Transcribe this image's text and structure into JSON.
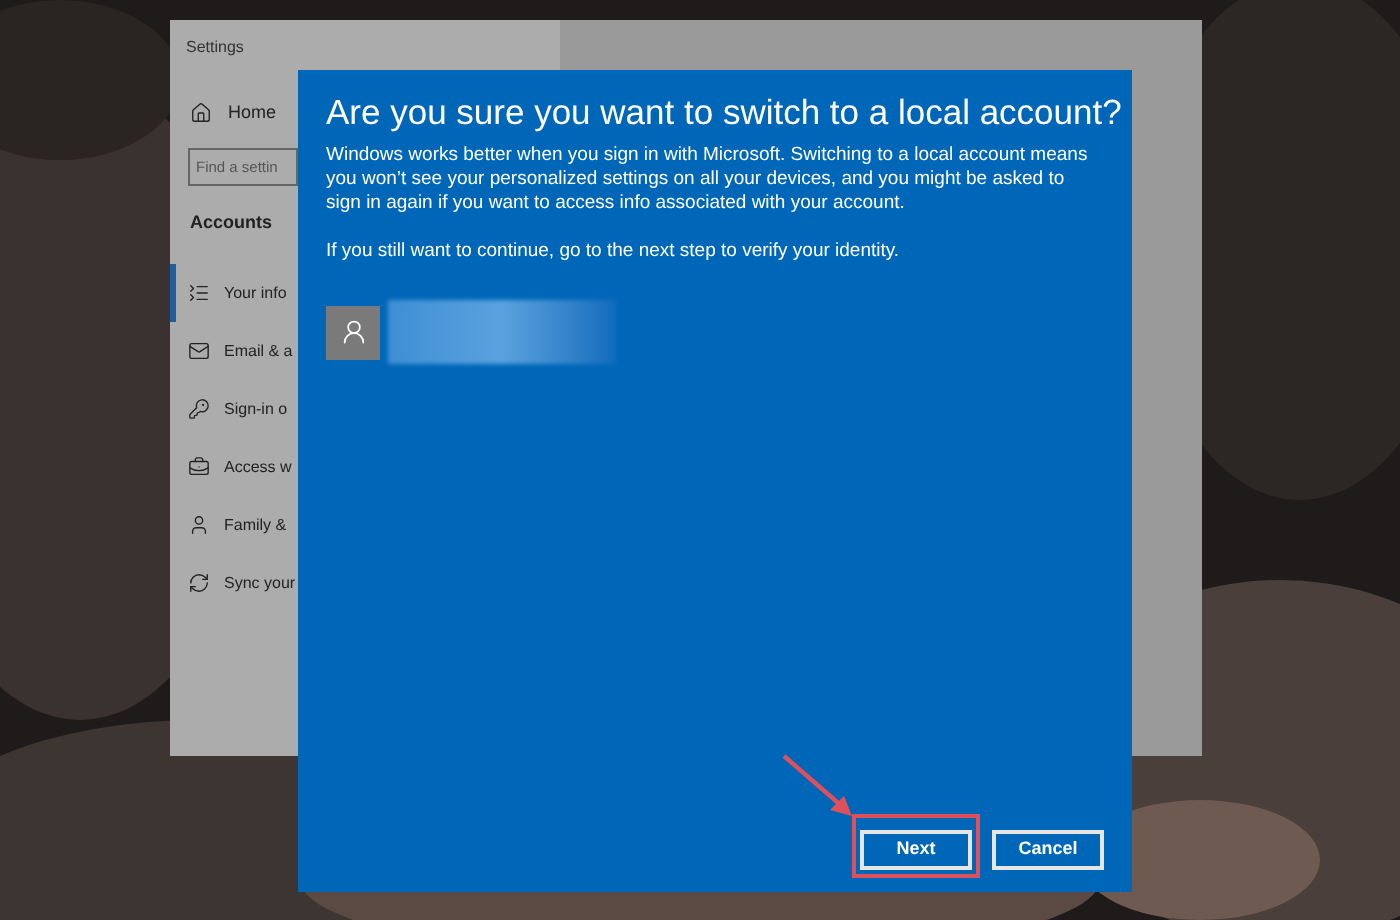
{
  "settings_window": {
    "title": "Settings",
    "home": "Home",
    "search": {
      "placeholder": "Find a settin"
    },
    "section": "Accounts",
    "items": [
      {
        "label": "Your info",
        "selected": true
      },
      {
        "label": "Email & a",
        "selected": false
      },
      {
        "label": "Sign-in o",
        "selected": false
      },
      {
        "label": "Access w",
        "selected": false
      },
      {
        "label": "Family &",
        "selected": false
      },
      {
        "label": "Sync your",
        "selected": false
      }
    ]
  },
  "dialog": {
    "title": "Are you sure you want to switch to a local account?",
    "body": "Windows works better when you sign in with Microsoft. Switching to a local account means you won’t see your personalized settings on all your devices, and you might be asked to sign in again if you want to access info associated with your account.",
    "note": "If you still want to continue, go to the next step to verify your identity.",
    "buttons": [
      {
        "label": "Next",
        "highlighted": true
      },
      {
        "label": "Cancel",
        "highlighted": false
      }
    ]
  }
}
